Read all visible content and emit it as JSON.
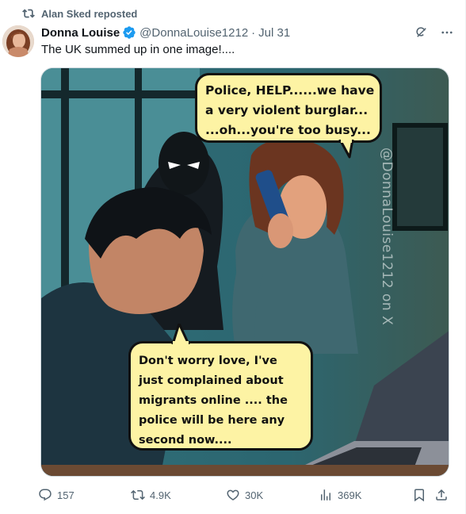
{
  "repost": {
    "label": "Alan Sked reposted"
  },
  "author": {
    "display_name": "Donna Louise",
    "handle": "@DonnaLouise1212",
    "separator": "·",
    "date": "Jul 31"
  },
  "tweet": {
    "text": "The UK summed up in one image!...."
  },
  "image": {
    "top_bubble_lines": [
      "Police, HELP......we have",
      "a very violent burglar...",
      "...oh...you're too busy..."
    ],
    "bottom_bubble_lines": [
      "Don't worry love, I've",
      "just complained about",
      "migrants online .... the",
      "police will be here any",
      "second now...."
    ],
    "watermark": "@DonnaLouise1212 on X"
  },
  "actions": {
    "replies": "157",
    "reposts": "4.9K",
    "likes": "30K",
    "views": "369K"
  },
  "colors": {
    "text_primary": "#0f1419",
    "text_secondary": "#536471",
    "verified_blue": "#1d9bf0",
    "bubble_fill": "#fdf3a4"
  },
  "icons": [
    "repost-icon",
    "verified-badge-icon",
    "grok-icon",
    "more-icon",
    "reply-icon",
    "retweet-icon",
    "like-icon",
    "views-icon",
    "bookmark-icon",
    "share-icon"
  ]
}
